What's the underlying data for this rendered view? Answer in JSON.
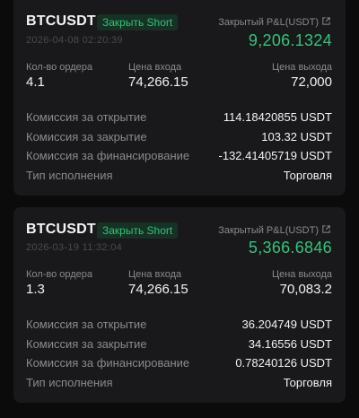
{
  "labels": {
    "pnl": "Закрытый P&L(USDT)",
    "qty": "Кол-во ордера",
    "entry_price": "Цена входа",
    "exit_price": "Цена выхода",
    "open_fee": "Комиссия за открытие",
    "close_fee": "Комиссия за закрытие",
    "funding_fee": "Комиссия за финансирование",
    "exec_type": "Тип исполнения"
  },
  "trades": [
    {
      "symbol": "BTCUSDT",
      "badge": "Закрыть Short",
      "timestamp": "2026-04-08 02:20:39",
      "pnl": "9,206.1324",
      "qty": "4.1",
      "entry_price": "74,266.15",
      "exit_price": "72,000",
      "open_fee": "114.18420855 USDT",
      "close_fee": "103.32 USDT",
      "funding_fee": "-132.41405719 USDT",
      "exec_type": "Торговля"
    },
    {
      "symbol": "BTCUSDT",
      "badge": "Закрыть Short",
      "timestamp": "2026-03-19 11:32:04",
      "pnl": "5,366.6846",
      "qty": "1.3",
      "entry_price": "74,266.15",
      "exit_price": "70,083.2",
      "open_fee": "36.204749 USDT",
      "close_fee": "34.16556 USDT",
      "funding_fee": "0.78240126 USDT",
      "exec_type": "Торговля"
    }
  ],
  "colors": {
    "profit": "#35c37a",
    "badge_bg": "#173124",
    "card_bg": "#19191b"
  },
  "icons": {
    "pnl_link": "external-link-icon"
  }
}
